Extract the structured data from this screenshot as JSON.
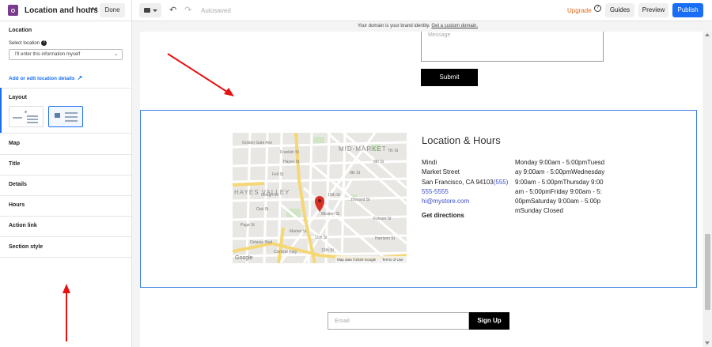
{
  "topbar": {
    "title": "Location and hours",
    "done_label": "Done",
    "autosaved": "Autosaved",
    "upgrade": "Upgrade",
    "help": "?",
    "guides": "Guides",
    "preview": "Preview",
    "publish": "Publish",
    "publish_color": "#1a6ef5",
    "upgrade_color": "#e06a1a"
  },
  "sidebar": {
    "location_heading": "Location",
    "select_location_label": "Select location",
    "select_value": "I'll enter this information myself",
    "add_edit_link": "Add or edit location details",
    "layout_heading": "Layout",
    "items": [
      "Map",
      "Title",
      "Details",
      "Hours",
      "Action link",
      "Section style"
    ]
  },
  "canvas": {
    "banner_text": "Your domain is your brand identity.",
    "banner_link": "Get a custom domain.",
    "message_placeholder": "Message",
    "submit_label": "Submit",
    "section": {
      "title": "Location & Hours",
      "name": "Mindi",
      "street": "Market Street",
      "city": "San Francisco, CA 94103",
      "phone_a": "(555)",
      "phone_b": "555-5555",
      "email": "hi@mystore.com",
      "directions": "Get directions",
      "hours_text": "Monday  9:00am - 5:00pmTuesday  9:00am - 5:00pmWednesday  9:00am - 5:00pmThursday  9:00am - 5:00pmFriday  9:00am - 5:00pmSaturday  9:00am - 5:00pmSunday  Closed"
    },
    "map": {
      "labels": {
        "mid_market": "MID-MARKET",
        "hayes_valley": "HAYES VALLEY",
        "golden_gate": "Golden Gate Ave",
        "fell": "Fell St",
        "central_fwy": "Central Fwy",
        "hayes_st": "Hayes St",
        "oak": "Oak St",
        "page": "Page St",
        "mission": "Mission St",
        "howard": "Howard St",
        "folsom": "Folsom St",
        "harrison": "Harrison St",
        "franklin": "Franklin St",
        "gough": "Gough St",
        "octavia": "Octavia Blvd",
        "market": "Market St",
        "s10th": "10th St",
        "s9th": "9th St",
        "s8th": "8th St",
        "s7th": "7th St",
        "s11th": "11th St",
        "s12th": "12th St"
      },
      "google": "Google",
      "map_data": "Map data ©2020 Google",
      "terms": "Terms of Use"
    },
    "email_placeholder": "Email",
    "signup_label": "Sign Up"
  },
  "annotation_color": "#e81010"
}
